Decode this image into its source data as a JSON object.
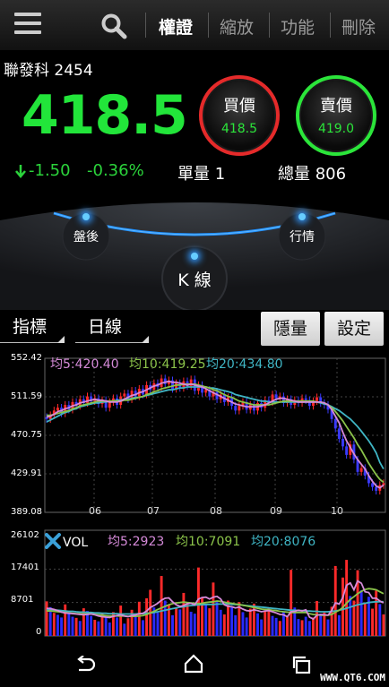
{
  "header": {
    "tabs": [
      {
        "label": "權證",
        "active": true
      },
      {
        "label": "縮放",
        "active": false
      },
      {
        "label": "功能",
        "active": false
      },
      {
        "label": "刪除",
        "active": false
      }
    ]
  },
  "quote": {
    "name": "聯發科 2454",
    "price": "418.5",
    "change": "-1.50",
    "change_pct": "-0.36%",
    "unit_volume_label": "單量 1",
    "total_volume_label": "總量 806"
  },
  "bid": {
    "label": "買價",
    "value": "418.5",
    "color": "#e52a2a"
  },
  "ask": {
    "label": "賣價",
    "value": "419.0",
    "color": "#2be53a"
  },
  "dial": {
    "left": "盤後",
    "center": "K 線",
    "right": "行情"
  },
  "controls": {
    "indicator_selector": "指標",
    "period_selector": "日線",
    "hide_volume_button": "隱量",
    "settings_button": "設定"
  },
  "chart_data": [
    {
      "type": "candlestick",
      "y_ticks": [
        "552.42",
        "511.59",
        "470.75",
        "429.91",
        "389.08"
      ],
      "ylim": [
        389.08,
        552.42
      ],
      "x_ticks": [
        "06",
        "07",
        "08",
        "09",
        "10"
      ],
      "legend": [
        {
          "name": "均5:420.40",
          "color": "#d58ad8"
        },
        {
          "name": "均10:419.25",
          "color": "#8bc34a"
        },
        {
          "name": "均20:434.80",
          "color": "#3fb5c4"
        }
      ],
      "close": [
        488,
        492,
        497,
        500,
        494,
        503,
        498,
        506,
        502,
        509,
        505,
        512,
        507,
        510,
        504,
        508,
        500,
        506,
        510,
        503,
        512,
        515,
        509,
        518,
        512,
        520,
        514,
        524,
        519,
        526,
        522,
        531,
        525,
        529,
        520,
        526,
        521,
        528,
        523,
        530,
        518,
        524,
        516,
        519,
        512,
        517,
        509,
        514,
        506,
        511,
        502,
        497,
        502,
        506,
        498,
        503,
        497,
        505,
        500,
        508,
        506,
        514,
        510,
        512,
        505,
        509,
        503,
        508,
        505,
        510,
        508,
        502,
        507,
        511,
        505,
        503,
        498,
        488,
        478,
        467,
        459,
        450,
        461,
        445,
        432,
        436,
        428,
        420,
        416,
        412,
        418,
        420
      ],
      "ma5": [
        490,
        491,
        493,
        496,
        497,
        499,
        500,
        502,
        503,
        505,
        506,
        507,
        508,
        509,
        508,
        508,
        507,
        506,
        506,
        506,
        507,
        509,
        511,
        513,
        514,
        516,
        517,
        519,
        521,
        523,
        524,
        526,
        527,
        528,
        527,
        527,
        526,
        525,
        524,
        525,
        524,
        523,
        522,
        520,
        518,
        516,
        514,
        512,
        510,
        508,
        506,
        504,
        503,
        502,
        501,
        501,
        501,
        501,
        502,
        503,
        505,
        507,
        509,
        510,
        510,
        509,
        508,
        507,
        506,
        506,
        506,
        506,
        506,
        506,
        506,
        505,
        503,
        498,
        491,
        484,
        474,
        465,
        458,
        451,
        445,
        440,
        435,
        428,
        422,
        417,
        415,
        418
      ],
      "ma10": [
        492,
        492,
        493,
        494,
        495,
        496,
        497,
        499,
        500,
        502,
        503,
        504,
        505,
        506,
        507,
        507,
        507,
        507,
        507,
        507,
        507,
        508,
        508,
        509,
        510,
        511,
        512,
        514,
        515,
        517,
        518,
        520,
        521,
        522,
        523,
        524,
        524,
        525,
        525,
        525,
        525,
        524,
        523,
        522,
        521,
        519,
        518,
        516,
        514,
        512,
        511,
        509,
        507,
        506,
        505,
        504,
        503,
        503,
        503,
        503,
        503,
        504,
        505,
        506,
        507,
        507,
        507,
        507,
        507,
        507,
        507,
        507,
        507,
        506,
        506,
        505,
        503,
        500,
        496,
        491,
        486,
        480,
        474,
        468,
        461,
        455,
        448,
        441,
        435,
        429,
        424,
        421
      ],
      "ma20": [
        485,
        487,
        489,
        491,
        493,
        495,
        496,
        498,
        499,
        501,
        502,
        503,
        504,
        505,
        505,
        506,
        506,
        507,
        507,
        508,
        508,
        509,
        509,
        510,
        511,
        511,
        512,
        513,
        514,
        515,
        516,
        517,
        518,
        519,
        519,
        520,
        521,
        521,
        522,
        522,
        522,
        522,
        522,
        522,
        521,
        521,
        520,
        519,
        518,
        517,
        516,
        514,
        513,
        512,
        511,
        510,
        509,
        508,
        507,
        507,
        506,
        506,
        506,
        506,
        506,
        506,
        506,
        506,
        506,
        506,
        506,
        506,
        506,
        506,
        505,
        504,
        503,
        501,
        499,
        497,
        494,
        491,
        488,
        484,
        480,
        475,
        470,
        465,
        459,
        452,
        442,
        435
      ]
    },
    {
      "type": "bar",
      "y_ticks": [
        "26102",
        "17401",
        "8701",
        "0"
      ],
      "ylim": [
        0,
        26102
      ],
      "title": "VOL",
      "legend": [
        {
          "name": "均5:2923",
          "color": "#d58ad8"
        },
        {
          "name": "均10:7091",
          "color": "#8bc34a"
        },
        {
          "name": "均20:8076",
          "color": "#3fb5c4"
        }
      ],
      "values": [
        9000,
        7500,
        6000,
        5500,
        4800,
        8200,
        6100,
        5000,
        4700,
        3900,
        7200,
        6500,
        5200,
        4200,
        3800,
        5800,
        4900,
        3500,
        6200,
        4800,
        7900,
        3200,
        4600,
        6800,
        5200,
        8900,
        4100,
        9800,
        12000,
        7400,
        6100,
        15600,
        9200,
        8200,
        5400,
        7300,
        6900,
        11200,
        8400,
        6300,
        5800,
        17800,
        10100,
        8300,
        7200,
        13900,
        9000,
        6800,
        5600,
        9200,
        7600,
        5400,
        8800,
        6200,
        4800,
        7100,
        8400,
        5900,
        4300,
        6600,
        7400,
        5200,
        4700,
        3900,
        6300,
        5100,
        17200,
        7400,
        4400,
        4100,
        5000,
        3900,
        4800,
        9100,
        5600,
        6100,
        4300,
        7600,
        18200,
        5400,
        15200,
        19800,
        10400,
        9200,
        17100,
        11900,
        8400,
        10200,
        7100,
        11800,
        8300,
        5600
      ],
      "colors": [
        "r",
        "b",
        "r",
        "b",
        "b",
        "r",
        "b",
        "b",
        "r",
        "b",
        "r",
        "b",
        "b",
        "r",
        "b",
        "r",
        "b",
        "b",
        "r",
        "b",
        "r",
        "b",
        "r",
        "r",
        "b",
        "r",
        "b",
        "r",
        "r",
        "b",
        "b",
        "r",
        "b",
        "r",
        "b",
        "r",
        "b",
        "r",
        "r",
        "b",
        "b",
        "r",
        "r",
        "b",
        "r",
        "r",
        "b",
        "b",
        "r",
        "r",
        "b",
        "b",
        "r",
        "b",
        "b",
        "r",
        "r",
        "b",
        "b",
        "r",
        "r",
        "b",
        "b",
        "r",
        "b",
        "r",
        "r",
        "b",
        "b",
        "r",
        "b",
        "b",
        "r",
        "r",
        "b",
        "r",
        "b",
        "r",
        "r",
        "b",
        "r",
        "r",
        "b",
        "r",
        "r",
        "b",
        "r",
        "b",
        "r",
        "r",
        "b",
        "r"
      ],
      "ma5": [
        7200,
        7100,
        6900,
        6600,
        6200,
        6000,
        5900,
        5800,
        5700,
        5600,
        5500,
        5600,
        5700,
        5500,
        5200,
        5000,
        4900,
        4800,
        5100,
        5300,
        5500,
        5200,
        5000,
        5300,
        5400,
        5800,
        5900,
        6500,
        7400,
        7900,
        8500,
        9300,
        9800,
        9900,
        8900,
        8100,
        7700,
        7900,
        8400,
        8500,
        8100,
        9600,
        10000,
        10100,
        9600,
        10100,
        10300,
        9600,
        8100,
        7700,
        7600,
        7300,
        7500,
        7000,
        6600,
        6500,
        6800,
        6600,
        6300,
        6500,
        6600,
        6300,
        6000,
        5600,
        5500,
        5000,
        6300,
        6400,
        6700,
        6500,
        6800,
        4900,
        4400,
        5400,
        5600,
        5500,
        5400,
        6600,
        8600,
        8300,
        10000,
        13200,
        13800,
        12000,
        14300,
        13700,
        11500,
        11300,
        9800,
        9800,
        9100,
        8600
      ],
      "ma10": [
        6500,
        6500,
        6400,
        6300,
        6200,
        6100,
        6000,
        5900,
        5800,
        5800,
        5700,
        5700,
        5700,
        5600,
        5500,
        5400,
        5300,
        5200,
        5200,
        5200,
        5200,
        5200,
        5100,
        5100,
        5100,
        5200,
        5300,
        5600,
        6000,
        6400,
        6900,
        7300,
        7700,
        8100,
        8400,
        8600,
        8700,
        8800,
        8700,
        8600,
        8500,
        8400,
        8500,
        8700,
        8800,
        8900,
        9100,
        9000,
        8800,
        8600,
        8500,
        8300,
        8200,
        8000,
        7800,
        7600,
        7400,
        7200,
        7000,
        6900,
        6800,
        6700,
        6600,
        6400,
        6300,
        6200,
        6100,
        6100,
        6100,
        6100,
        6100,
        5800,
        5600,
        5500,
        5400,
        5400,
        5400,
        5600,
        6200,
        6700,
        7400,
        8500,
        9500,
        10200,
        11000,
        11600,
        12100,
        12300,
        12200,
        12000,
        11500,
        11000
      ],
      "ma20": [
        6800,
        6800,
        6700,
        6700,
        6600,
        6500,
        6400,
        6400,
        6300,
        6200,
        6200,
        6100,
        6100,
        6000,
        6000,
        5900,
        5900,
        5800,
        5800,
        5800,
        5700,
        5700,
        5700,
        5700,
        5700,
        5800,
        5800,
        5900,
        6000,
        6100,
        6300,
        6500,
        6700,
        6900,
        7100,
        7300,
        7500,
        7600,
        7800,
        7900,
        8000,
        8100,
        8100,
        8200,
        8200,
        8200,
        8300,
        8300,
        8300,
        8300,
        8200,
        8200,
        8100,
        8000,
        7900,
        7800,
        7700,
        7600,
        7500,
        7400,
        7300,
        7200,
        7100,
        7000,
        6900,
        6800,
        6700,
        6700,
        6600,
        6600,
        6500,
        6500,
        6400,
        6400,
        6300,
        6300,
        6300,
        6400,
        6500,
        6700,
        6900,
        7200,
        7500,
        7800,
        8100,
        8300,
        8500,
        8700,
        8800,
        8900,
        8900,
        8900
      ]
    }
  ],
  "watermark": "WWW.QT6.COM"
}
